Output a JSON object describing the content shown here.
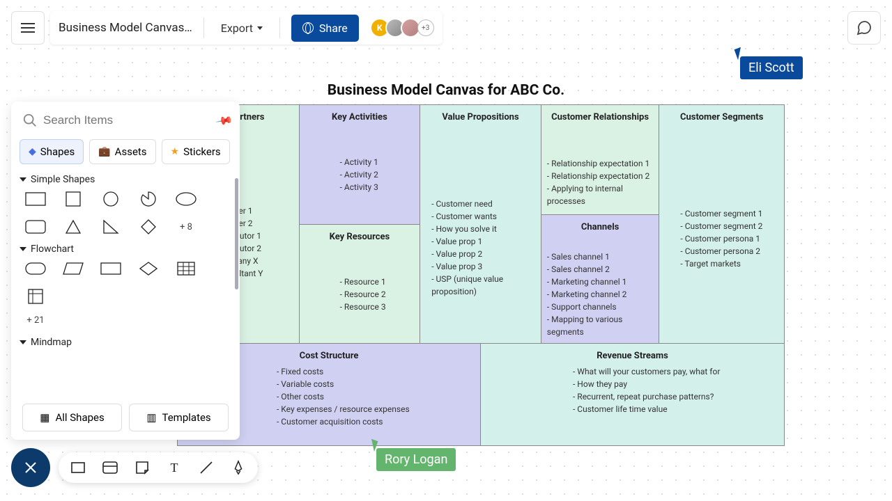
{
  "header": {
    "doc_title": "Business Model Canvas…",
    "export_label": "Export",
    "share_label": "Share",
    "avatar_letter": "K",
    "avatar_more": "+3"
  },
  "cursors": {
    "eli": "Eli Scott",
    "rory": "Rory Logan"
  },
  "canvas": {
    "title": "Business Model Canvas for ABC Co.",
    "partners_head": "Key Partners",
    "partners": [
      "Supplier 1",
      "Supplier 2",
      "Distributor 1",
      "Distributor 2",
      "Company X",
      "Consultant Y"
    ],
    "activities_head": "Key Activities",
    "activities": [
      "Activity 1",
      "Activity 2",
      "Activity 3"
    ],
    "resources_head": "Key Resources",
    "resources": [
      "Resource 1",
      "Resource 2",
      "Resource 3"
    ],
    "value_head": "Value Propositions",
    "value": [
      "Customer need",
      "Customer wants",
      "How you solve it",
      "Value prop 1",
      "Value prop 2",
      "Value prop 3",
      "USP (unique value proposition)"
    ],
    "rel_head": "Customer Relationships",
    "rel": [
      "Relationship expectation 1",
      "Relationship expectation 2",
      "Applying to internal processes"
    ],
    "channels_head": "Channels",
    "channels": [
      "Sales channel 1",
      "Sales channel 2",
      "Marketing channel 1",
      "Marketing channel 2",
      "Support channels",
      "Mapping to various segments"
    ],
    "segments_head": "Customer Segments",
    "segments": [
      "Customer segment 1",
      "Customer segment 2",
      "Customer persona 1",
      "Customer persona 2",
      "Target markets"
    ],
    "cost_head": "Cost Structure",
    "cost": [
      "Fixed costs",
      "Variable costs",
      "Other costs",
      "Key expenses / resource expenses",
      "Customer acquisition costs"
    ],
    "revenue_head": "Revenue Streams",
    "revenue": [
      "What will your customers pay, what for",
      "How they pay",
      "Recurrent, repeat purchase patterns?",
      "Customer life time value"
    ]
  },
  "panel": {
    "search_placeholder": "Search Items",
    "tabs": {
      "shapes": "Shapes",
      "assets": "Assets",
      "stickers": "Stickers"
    },
    "sections": {
      "simple": "Simple Shapes",
      "flowchart": "Flowchart",
      "mindmap": "Mindmap"
    },
    "more_simple": "+ 8",
    "more_flow": "+ 21",
    "all_shapes": "All Shapes",
    "templates": "Templates"
  }
}
